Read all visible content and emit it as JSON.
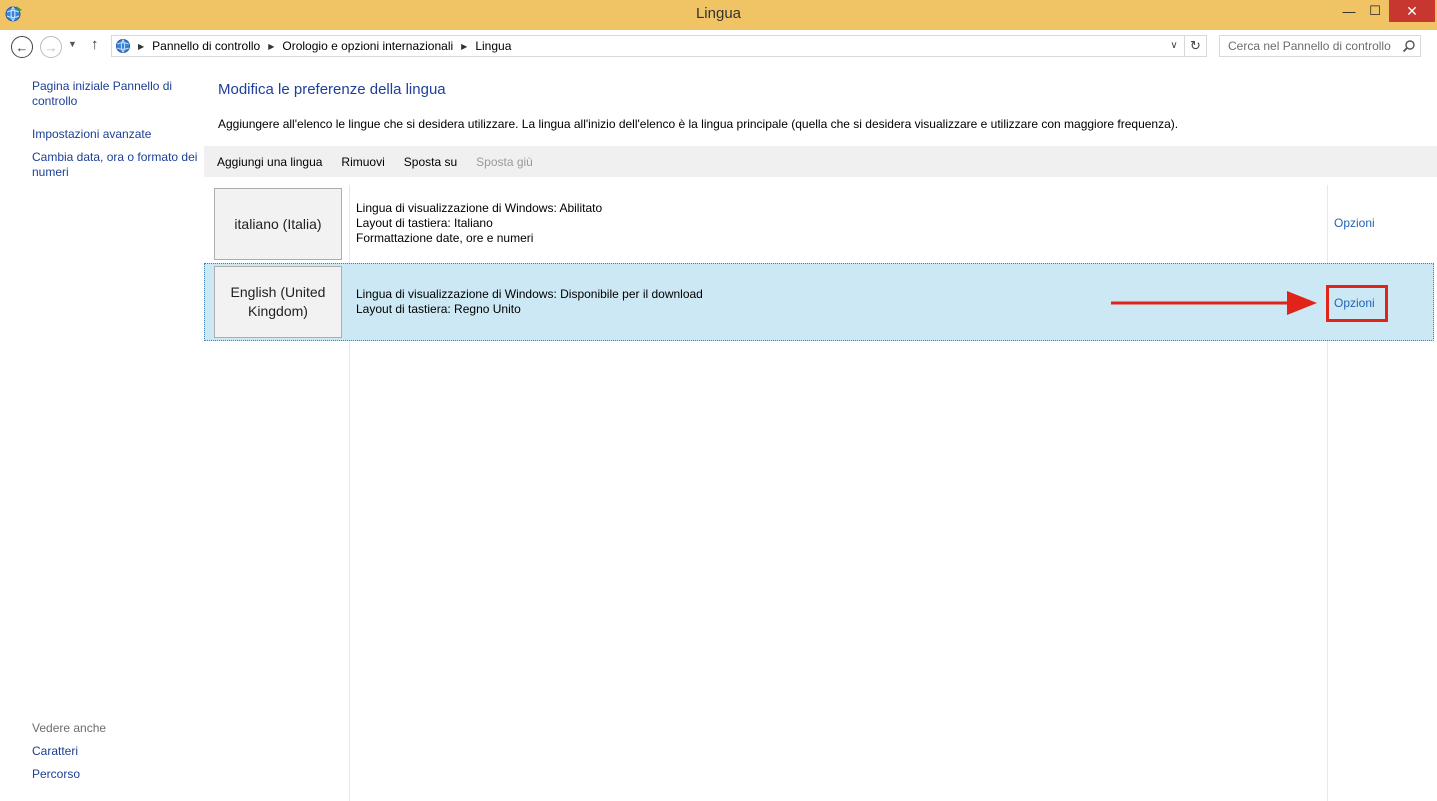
{
  "window": {
    "title": "Lingua",
    "controls": {
      "minimize": "—",
      "maximize": "☐",
      "close": "✕"
    }
  },
  "address_bar": {
    "breadcrumbs": [
      "Pannello di controllo",
      "Orologio e opzioni internazionali",
      "Lingua"
    ],
    "search_placeholder": "Cerca nel Pannello di controllo"
  },
  "left_pane": {
    "links": [
      "Pagina iniziale Pannello di controllo",
      "Impostazioni avanzate",
      "Cambia data, ora o formato dei numeri"
    ],
    "see_also_title": "Vedere anche",
    "see_also_links": [
      "Caratteri",
      "Percorso"
    ]
  },
  "main": {
    "title": "Modifica le preferenze della lingua",
    "description": "Aggiungere all'elenco le lingue che si desidera utilizzare. La lingua all'inizio dell'elenco è la lingua principale (quella che si desidera visualizzare e utilizzare con maggiore frequenza).",
    "toolbar": {
      "add": "Aggiungi una lingua",
      "remove": "Rimuovi",
      "move_up": "Sposta su",
      "move_down": "Sposta giù"
    },
    "languages": [
      {
        "name": "italiano (Italia)",
        "details": [
          "Lingua di visualizzazione di Windows: Abilitato",
          "Layout di tastiera: Italiano",
          "Formattazione date, ore e numeri"
        ],
        "options": "Opzioni",
        "selected": false
      },
      {
        "name": "English (United Kingdom)",
        "details": [
          "Lingua di visualizzazione di Windows: Disponibile per il download",
          "Layout di tastiera: Regno Unito"
        ],
        "options": "Opzioni",
        "selected": true
      }
    ]
  },
  "colors": {
    "titlebar": "#f0c465",
    "close_button": "#c7362f",
    "link": "#1c3f94",
    "selected_row": "#cce8f4",
    "callout": "#e2231a"
  },
  "icons": {
    "app": "globe-clock-icon",
    "back": "back-arrow-icon",
    "forward": "forward-arrow-icon",
    "up": "up-arrow-icon",
    "search": "magnifier-icon",
    "refresh": "refresh-icon"
  }
}
